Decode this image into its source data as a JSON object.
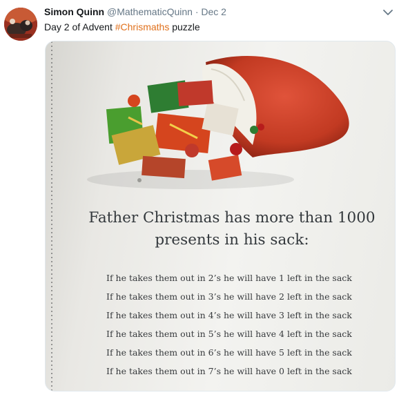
{
  "tweet": {
    "author_name": "Simon Quinn",
    "handle": "@MathematicQuinn",
    "separator": "·",
    "date": "Dec 2",
    "text_before": "Day 2 of Advent ",
    "hashtag": "#Chrismaths",
    "text_after": " puzzle"
  },
  "image": {
    "title_line1": "Father Christmas has more than 1000",
    "title_line2": "presents in his sack:",
    "rules": [
      "If he takes them out in 2’s he will have 1 left in the sack",
      "If he takes them out in 3’s he will have 2 left in the sack",
      "If he takes them out in 4’s he will have 3 left in the sack",
      "If he takes them out in 5’s he will have 4 left in the sack",
      "If he takes them out in 6’s he will have 5 left in the sack",
      "If he takes them out in 7’s he will have 0 left in the sack"
    ]
  },
  "colors": {
    "hashtag": "#e0701b",
    "sack": "#c23a22",
    "meta": "#657786"
  },
  "icons": {
    "menu": "chevron-down-icon"
  }
}
